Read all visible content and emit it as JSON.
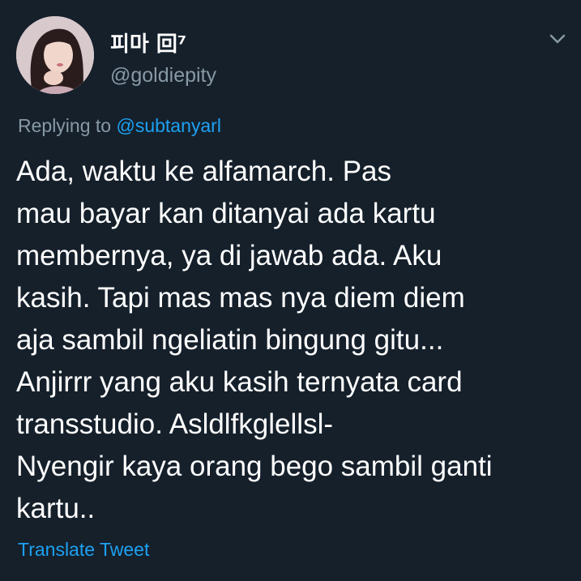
{
  "tweet": {
    "display_name": "피마 回⁷",
    "handle": "@goldiepity",
    "avatar_icon": "user-avatar-photo",
    "menu_icon": "chevron-down-icon",
    "replying_prefix": "Replying to ",
    "replying_to": "@subtanyarl",
    "text": "Ada, waktu ke alfamarch. Pas\nmau bayar kan ditanyai ada kartu\nmembernya, ya di jawab ada. Aku\nkasih. Tapi mas mas nya diem diem\naja sambil ngeliatin bingung gitu...\nAnjirrr yang aku kasih ternyata card\ntransstudio. Asldlfkglellsl-\nNyengir kaya orang bego sambil ganti\nkartu..",
    "translate_label": "Translate Tweet"
  },
  "colors": {
    "background": "#15202b",
    "primary_text": "#ffffff",
    "secondary_text": "#8899a6",
    "link": "#1da1f2"
  }
}
